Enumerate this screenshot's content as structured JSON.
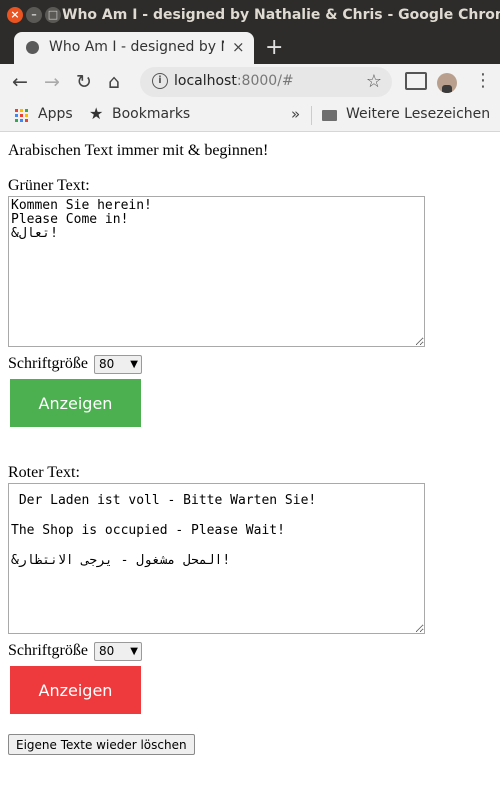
{
  "window": {
    "title": "Who Am I - designed by Nathalie & Chris - Google Chrome",
    "controls": {
      "close": "×",
      "minimize": "–",
      "maximize": "□"
    }
  },
  "tab": {
    "title": "Who Am I - designed by Nathalie & Chris",
    "close": "×",
    "new_tab": "+"
  },
  "toolbar": {
    "back": "←",
    "forward": "→",
    "reload": "↻",
    "home": "⌂",
    "info": "i",
    "url_host": "localhost",
    "url_rest": ":8000/#",
    "star": "☆",
    "menu": "⋮"
  },
  "bookmarks": {
    "apps": "Apps",
    "bookmarks": "Bookmarks",
    "overflow": "»",
    "other": "Weitere Lesezeichen"
  },
  "page": {
    "instruction": "Arabischen Text immer mit & beginnen!",
    "green": {
      "label": "Grüner Text:",
      "text": "Kommen Sie herein!\nPlease Come in!\n&تعال!",
      "size_label": "Schriftgröße",
      "size_value": "80",
      "button": "Anzeigen",
      "color": "#4caf50"
    },
    "red": {
      "label": "Roter Text:",
      "text": " Der Laden ist voll - Bitte Warten Sie!\nThe Shop is occupied - Please Wait!\n&المحل مشغول - يرجى الانتظار!",
      "size_label": "Schriftgröße",
      "size_value": "80",
      "button": "Anzeigen",
      "color": "#ee3a3d"
    },
    "clear_button": "Eigene Texte wieder löschen"
  },
  "icons": [
    "close-icon",
    "minimize-icon",
    "maximize-icon",
    "globe-favicon-icon",
    "back-icon",
    "forward-icon",
    "reload-icon",
    "home-icon",
    "info-icon",
    "star-icon",
    "cast-icon",
    "avatar",
    "menu-icon",
    "apps-icon",
    "bookmark-star-icon",
    "chevron-icon",
    "folder-icon",
    "dropdown-arrow-icon"
  ]
}
